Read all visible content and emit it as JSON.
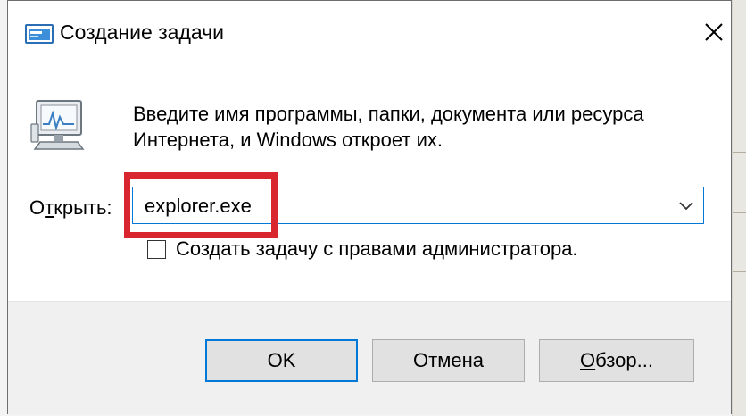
{
  "window": {
    "title": "Создание задачи"
  },
  "description": {
    "line1": "Введите имя программы, папки, документа или ресурса",
    "line2": "Интернета, и Windows откроет их."
  },
  "open_field": {
    "label_prefix": "О",
    "label_mnemonic": "т",
    "label_suffix": "крыть:",
    "value": "explorer.exe"
  },
  "admin_option": {
    "label": "Создать задачу с правами администратора.",
    "checked": false
  },
  "buttons": {
    "ok_label": "OK",
    "cancel_label": "Отмена",
    "browse_mnemonic": "О",
    "browse_rest": "бзор..."
  },
  "colors": {
    "highlight": "#d9262e",
    "focus_border": "#0078d7"
  },
  "icons": {
    "title": "run-dialog-icon",
    "program": "program-monitor-icon",
    "close": "close-icon",
    "dropdown": "chevron-down-icon"
  }
}
